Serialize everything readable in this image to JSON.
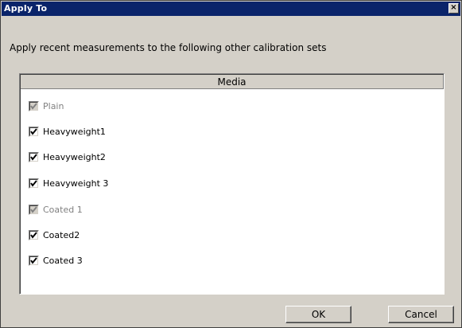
{
  "window": {
    "title": "Apply To",
    "close_glyph": "×"
  },
  "instruction": "Apply recent measurements to the following other calibration sets",
  "list": {
    "header": "Media",
    "items": [
      {
        "label": "Plain",
        "checked": true,
        "enabled": false
      },
      {
        "label": "Heavyweight1",
        "checked": true,
        "enabled": true
      },
      {
        "label": "Heavyweight2",
        "checked": true,
        "enabled": true
      },
      {
        "label": "Heavyweight 3",
        "checked": true,
        "enabled": true
      },
      {
        "label": "Coated 1",
        "checked": true,
        "enabled": false
      },
      {
        "label": "Coated2",
        "checked": true,
        "enabled": true
      },
      {
        "label": "Coated 3",
        "checked": true,
        "enabled": true
      }
    ]
  },
  "buttons": {
    "ok_label": "OK",
    "cancel_label": "Cancel"
  },
  "colors": {
    "titlebar": "#0a246a",
    "dialog_face": "#d4d0c8",
    "disabled_text": "#808080"
  }
}
